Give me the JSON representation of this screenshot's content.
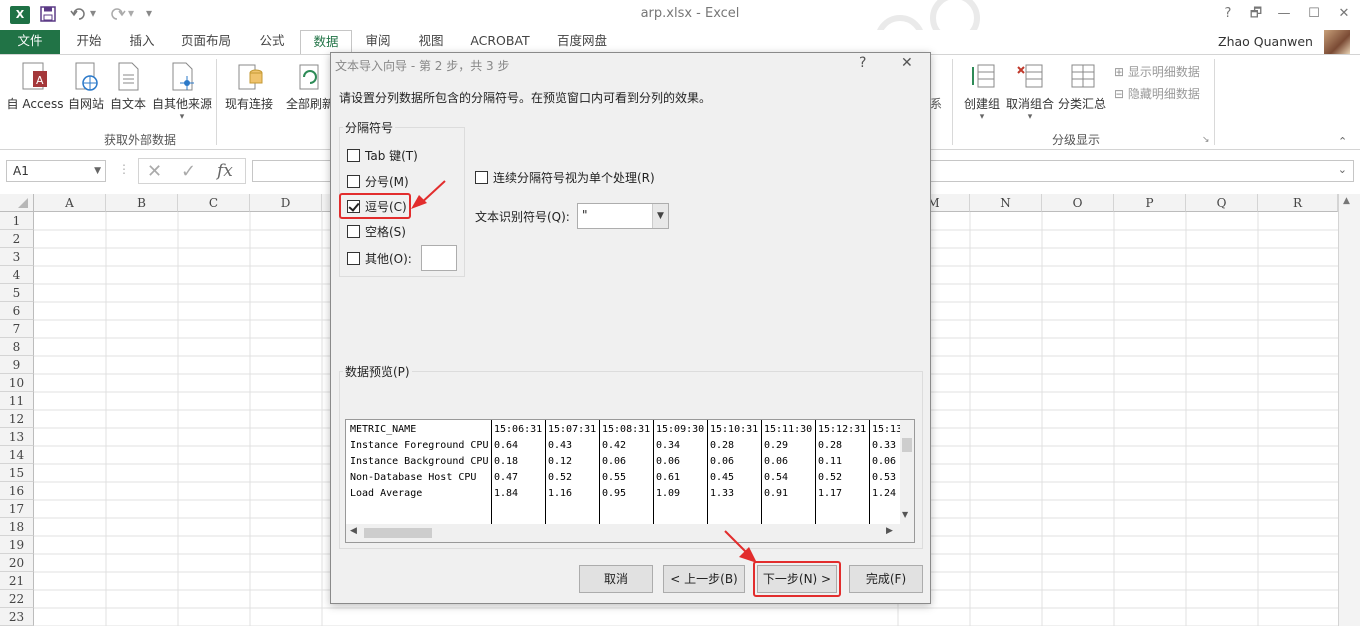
{
  "titlebar": {
    "app_icon": "X",
    "window_title": "arp.xlsx - Excel",
    "help": "?",
    "restore_glyph": "🗗",
    "minimize": "—",
    "maximize": "☐",
    "close": "✕"
  },
  "ribbon_tabs": {
    "file": "文件",
    "tabs": [
      "开始",
      "插入",
      "页面布局",
      "公式",
      "数据",
      "审阅",
      "视图",
      "ACROBAT",
      "百度网盘"
    ],
    "active_index": 4,
    "user_name": "Zhao Quanwen"
  },
  "ribbon": {
    "external_data": {
      "buttons": [
        "自 Access",
        "自网站",
        "自文本",
        "自其他来源",
        "现有连接",
        "全部刷新"
      ],
      "group_label": "获取外部数据"
    },
    "outline": {
      "buttons": [
        "创建组",
        "取消组合",
        "分类汇总"
      ],
      "small_items": [
        "显示明细数据",
        "隐藏明细数据"
      ],
      "group_label": "分级显示",
      "partial_label": "系"
    }
  },
  "formula_bar": {
    "name_box": "A1",
    "fx": "fx"
  },
  "grid": {
    "columns": [
      "A",
      "B",
      "C",
      "D",
      "M",
      "N",
      "O",
      "P",
      "Q",
      "R"
    ],
    "rows": [
      "1",
      "2",
      "3",
      "4",
      "5",
      "6",
      "7",
      "8",
      "9",
      "10",
      "11",
      "12",
      "13",
      "14",
      "15",
      "16",
      "17",
      "18",
      "19",
      "20",
      "21",
      "22",
      "23"
    ]
  },
  "dialog": {
    "title": "文本导入向导 - 第 2 步，共 3 步",
    "help": "?",
    "close": "✕",
    "description": "请设置分列数据所包含的分隔符号。在预览窗口内可看到分列的效果。",
    "delimiters_label": "分隔符号",
    "delimiters": [
      {
        "label": "Tab 键(T)",
        "checked": false
      },
      {
        "label": "分号(M)",
        "checked": false
      },
      {
        "label": "逗号(C)",
        "checked": true
      },
      {
        "label": "空格(S)",
        "checked": false
      },
      {
        "label": "其他(O):",
        "checked": false
      }
    ],
    "consecutive_label": "连续分隔符号视为单个处理(R)",
    "consecutive_checked": false,
    "qualifier_label": "文本识别符号(Q):",
    "qualifier_value": "\"",
    "preview_label": "数据预览(P)",
    "preview_header": [
      "METRIC_NAME",
      "15:06:31",
      "15:07:31",
      "15:08:31",
      "15:09:30",
      "15:10:31",
      "15:11:30",
      "15:12:31",
      "15:13"
    ],
    "preview_rows": [
      [
        "Instance Foreground CPU",
        "0.64",
        "0.43",
        "0.42",
        "0.34",
        "0.28",
        "0.29",
        "0.28",
        "0.33"
      ],
      [
        "Instance Background CPU",
        "0.18",
        "0.12",
        "0.06",
        "0.06",
        "0.06",
        "0.06",
        "0.11",
        "0.06"
      ],
      [
        "Non-Database Host CPU",
        "0.47",
        "0.52",
        "0.55",
        "0.61",
        "0.45",
        "0.54",
        "0.52",
        "0.53"
      ],
      [
        "Load Average",
        "1.84",
        "1.16",
        "0.95",
        "1.09",
        "1.33",
        "0.91",
        "1.17",
        "1.24"
      ]
    ],
    "buttons": {
      "cancel": "取消",
      "back": "< 上一步(B)",
      "next": "下一步(N) >",
      "finish": "完成(F)"
    }
  },
  "colors": {
    "excel_green": "#217346",
    "annotation_red": "#e22d2d"
  }
}
